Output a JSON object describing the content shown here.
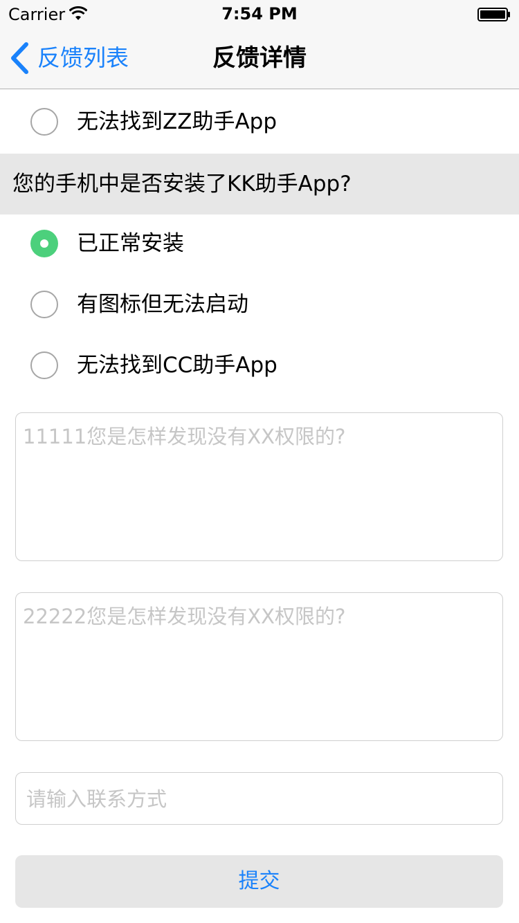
{
  "status_bar": {
    "carrier": "Carrier",
    "time": "7:54 PM",
    "wifi_icon": "wifi-icon",
    "battery_icon": "battery-icon"
  },
  "nav_bar": {
    "back_label": "反馈列表",
    "title": "反馈详情",
    "accent_color": "#1a82fb"
  },
  "question_prev": {
    "options": [
      {
        "label": "无法找到ZZ助手App",
        "selected": false
      }
    ]
  },
  "question_kk": {
    "header": "您的手机中是否安装了KK助手App?",
    "options": [
      {
        "label": "已正常安装",
        "selected": true
      },
      {
        "label": "有图标但无法启动",
        "selected": false
      },
      {
        "label": "无法找到CC助手App",
        "selected": false
      }
    ],
    "selected_color": "#4cd07c"
  },
  "text_fields": {
    "field1_placeholder": "11111您是怎样发现没有XX权限的?",
    "field2_placeholder": "22222您是怎样发现没有XX权限的?",
    "contact_placeholder": "请输入联系方式"
  },
  "submit": {
    "label": "提交"
  }
}
